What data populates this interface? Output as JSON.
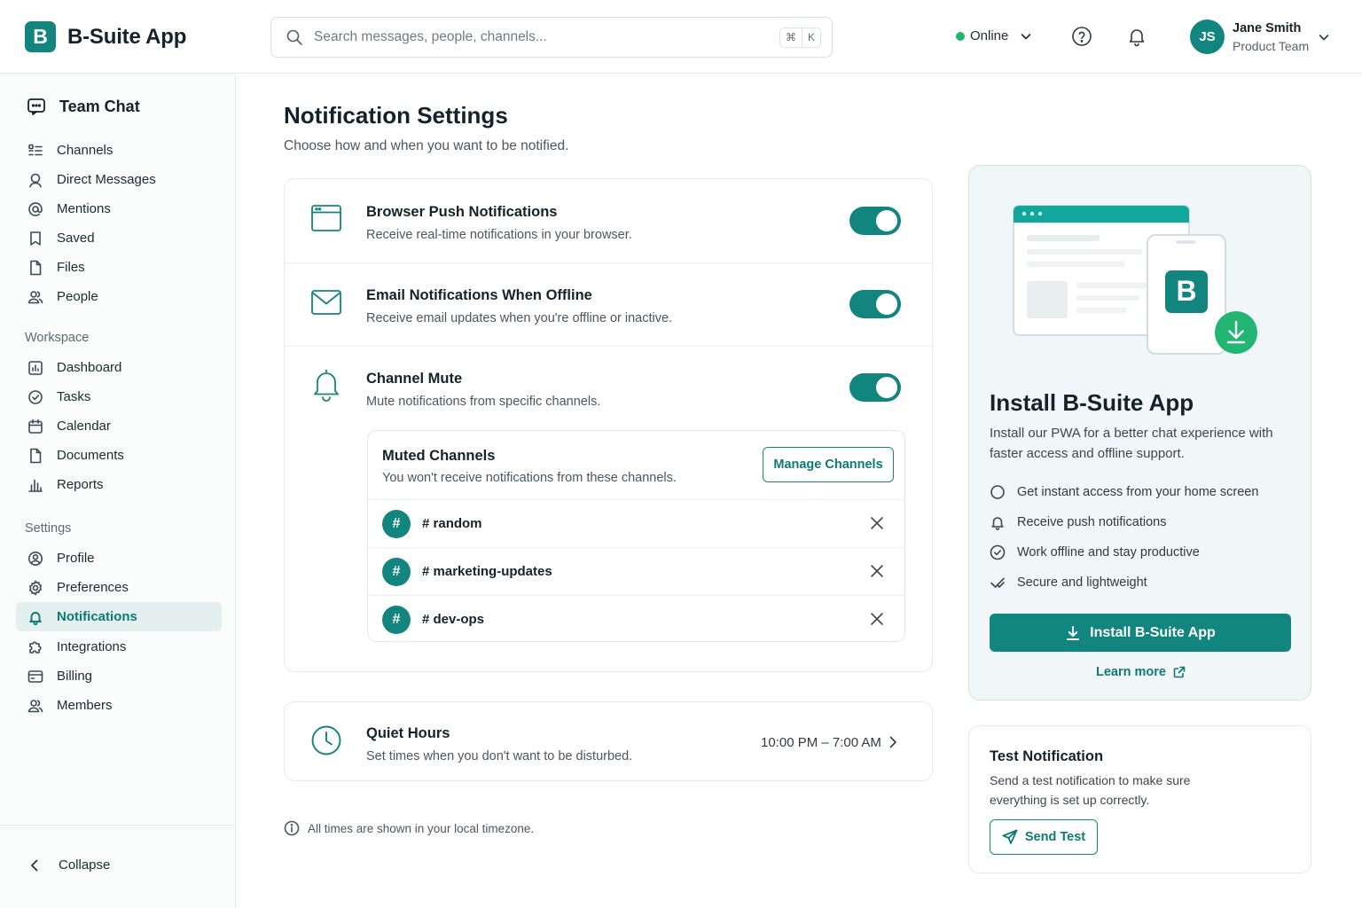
{
  "app": {
    "logo_letter": "B",
    "name": "B-Suite App"
  },
  "search": {
    "placeholder": "Search messages, people, channels...",
    "shortcut_mod": "⌘",
    "shortcut_key": "K"
  },
  "status": {
    "label": "Online",
    "color": "#22b573"
  },
  "user": {
    "initials": "JS",
    "name": "Jane Smith",
    "team": "Product Team"
  },
  "sidebar": {
    "header": "Team Chat",
    "chat_items": [
      {
        "label": "Channels",
        "icon": "channels-icon"
      },
      {
        "label": "Direct Messages",
        "icon": "search-person-icon"
      },
      {
        "label": "Mentions",
        "icon": "at-icon"
      },
      {
        "label": "Saved",
        "icon": "bookmark-icon"
      },
      {
        "label": "Files",
        "icon": "file-icon"
      },
      {
        "label": "People",
        "icon": "people-icon"
      }
    ],
    "workspace_label": "Workspace",
    "workspace_items": [
      {
        "label": "Dashboard",
        "icon": "dashboard-icon"
      },
      {
        "label": "Tasks",
        "icon": "check-circle-icon"
      },
      {
        "label": "Calendar",
        "icon": "calendar-icon"
      },
      {
        "label": "Documents",
        "icon": "document-icon"
      },
      {
        "label": "Reports",
        "icon": "bar-chart-icon"
      }
    ],
    "settings_label": "Settings",
    "settings_items": [
      {
        "label": "Profile",
        "icon": "user-circle-icon"
      },
      {
        "label": "Preferences",
        "icon": "gear-icon"
      },
      {
        "label": "Notifications",
        "icon": "bell-icon",
        "active": true
      },
      {
        "label": "Integrations",
        "icon": "puzzle-icon"
      },
      {
        "label": "Billing",
        "icon": "billing-icon"
      },
      {
        "label": "Members",
        "icon": "members-icon"
      }
    ],
    "collapse": "Collapse"
  },
  "main": {
    "title": "Notification Settings",
    "subtitle": "Choose how and when you want to be notified.",
    "settings": [
      {
        "title": "Browser Push Notifications",
        "desc": "Receive real-time notifications in your browser.",
        "enabled": true
      },
      {
        "title": "Email Notifications When Offline",
        "desc": "Receive email updates when you're offline or inactive.",
        "enabled": true
      },
      {
        "title": "Channel Mute",
        "desc": "Mute notifications from specific channels.",
        "enabled": true
      }
    ],
    "muted": {
      "title": "Muted Channels",
      "desc": "You won't receive notifications from these channels.",
      "manage_label": "Manage Channels",
      "channels": [
        {
          "badge": "#",
          "name": "# random"
        },
        {
          "badge": "#",
          "name": "# marketing-updates"
        },
        {
          "badge": "#",
          "name": "# dev-ops"
        }
      ]
    },
    "quiet": {
      "title": "Quiet Hours",
      "desc": "Set times when you don't want to be disturbed.",
      "time": "10:00 PM – 7:00 AM"
    },
    "timezone_note": "All times are shown in your local timezone."
  },
  "install": {
    "logo_letter": "B",
    "title": "Install B-Suite App",
    "desc": "Install our PWA for a better chat experience with faster access and offline support.",
    "features": [
      {
        "label": "Get instant access from your home screen",
        "icon": "circle-icon"
      },
      {
        "label": "Receive push notifications",
        "icon": "bell-icon"
      },
      {
        "label": "Work offline and stay productive",
        "icon": "check-circle-icon"
      },
      {
        "label": "Secure and lightweight",
        "icon": "check-icon"
      }
    ],
    "button": "Install B-Suite App",
    "learn_more": "Learn more"
  },
  "test": {
    "title": "Test Notification",
    "desc": "Send a test notification to make sure everything is set up correctly.",
    "button": "Send Test"
  },
  "colors": {
    "accent": "#12857f",
    "accent_light_bg": "#e3f0ef",
    "download_green": "#22b573"
  }
}
